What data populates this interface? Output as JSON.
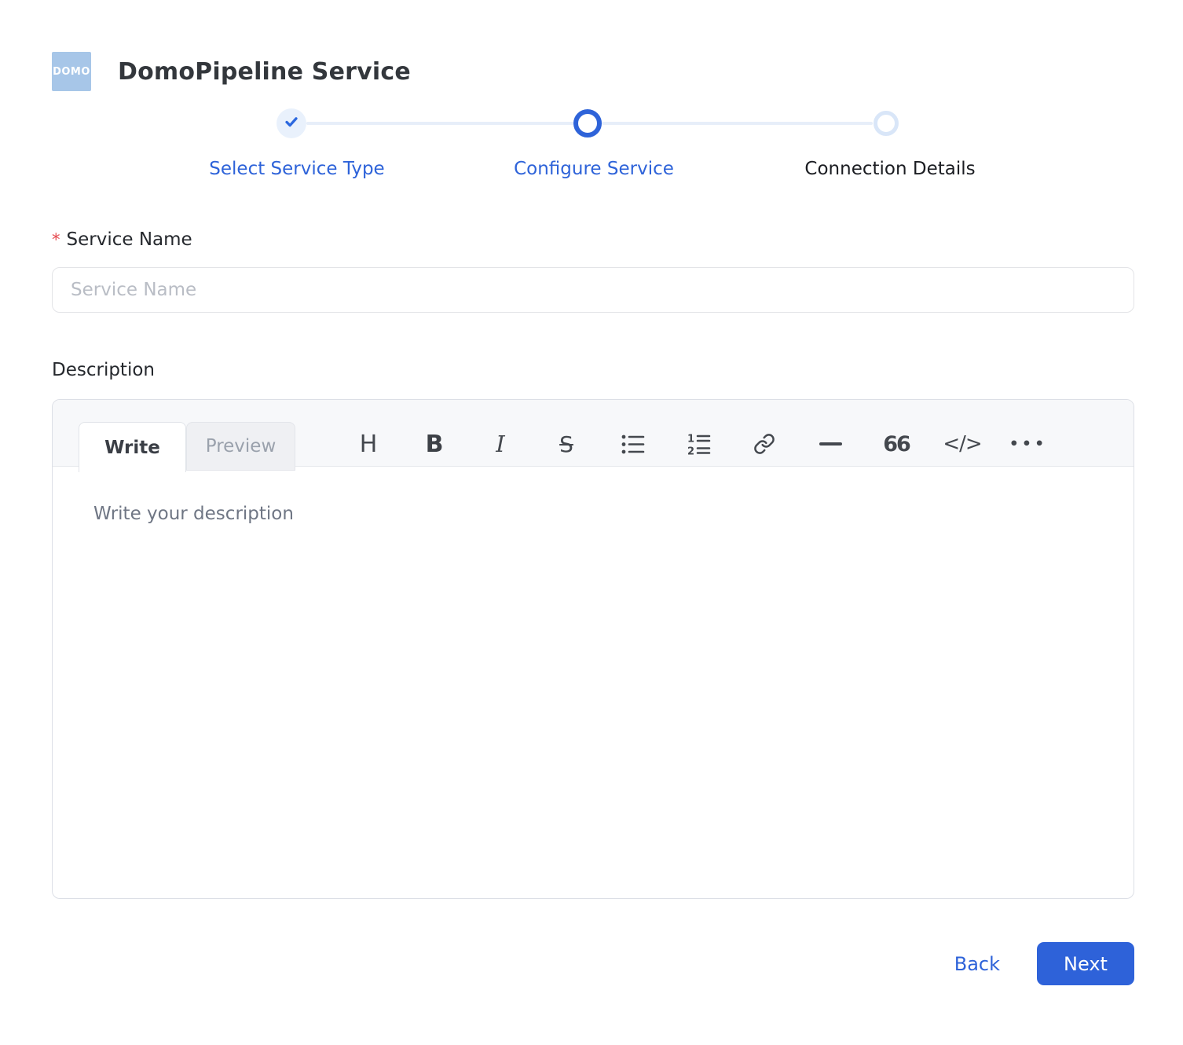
{
  "header": {
    "logo_text": "DOMO",
    "title": "DomoPipeline Service"
  },
  "stepper": {
    "steps": [
      {
        "label": "Select Service Type",
        "state": "completed"
      },
      {
        "label": "Configure Service",
        "state": "active"
      },
      {
        "label": "Connection Details",
        "state": "upcoming"
      }
    ]
  },
  "form": {
    "service_name": {
      "required_marker": "*",
      "label": "Service Name",
      "placeholder": "Service Name",
      "value": ""
    },
    "description": {
      "label": "Description",
      "tabs": [
        {
          "label": "Write",
          "active": true
        },
        {
          "label": "Preview",
          "active": false
        }
      ],
      "toolbar": {
        "heading": "H",
        "bold": "B",
        "italic": "I",
        "strikethrough": "S",
        "quote": "66",
        "code": "</>",
        "more": "•••"
      },
      "placeholder": "Write your description",
      "value": ""
    }
  },
  "actions": {
    "back_label": "Back",
    "next_label": "Next"
  },
  "colors": {
    "accent_blue": "#2e63d9",
    "next_button_bg": "#2e62d9",
    "logo_bg": "#a7c6e8",
    "required_red": "#e5484d",
    "step_inactive_ring": "#d9e6f8"
  }
}
